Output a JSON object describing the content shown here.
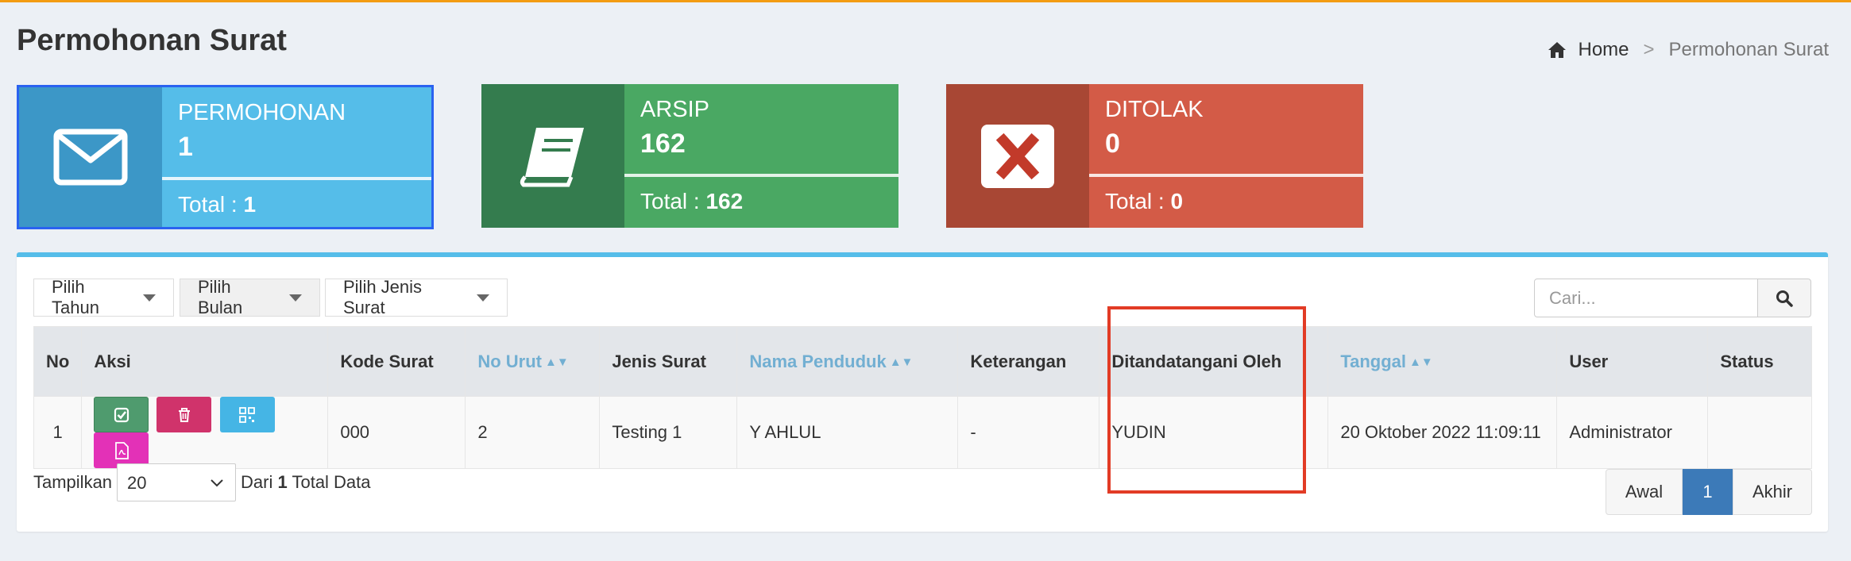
{
  "page": {
    "title": "Permohonan Surat"
  },
  "breadcrumb": {
    "home": "Home",
    "separator": ">",
    "current": "Permohonan Surat"
  },
  "infoboxes": {
    "permohonan": {
      "label": "PERMOHONAN",
      "number": "1",
      "total_label": "Total : ",
      "total_value": "1",
      "icon": "envelope-icon",
      "color": "#55bde9"
    },
    "arsip": {
      "label": "ARSIP",
      "number": "162",
      "total_label": "Total : ",
      "total_value": "162",
      "icon": "book-icon",
      "color": "#4aa863"
    },
    "ditolak": {
      "label": "DITOLAK",
      "number": "0",
      "total_label": "Total : ",
      "total_value": "0",
      "icon": "close-icon",
      "color": "#d35b47"
    }
  },
  "filters": {
    "tahun": "Pilih Tahun",
    "bulan": "Pilih Bulan",
    "jenis": "Pilih Jenis Surat"
  },
  "search": {
    "placeholder": "Cari..."
  },
  "table": {
    "headers": {
      "no": "No",
      "aksi": "Aksi",
      "kode": "Kode Surat",
      "urut": "No Urut",
      "jenis": "Jenis Surat",
      "nama": "Nama Penduduk",
      "ket": "Keterangan",
      "ttd": "Ditandatangani Oleh",
      "tanggal": "Tanggal",
      "user": "User",
      "status": "Status"
    },
    "rows": [
      {
        "no": "1",
        "kode": "000",
        "urut": "2",
        "jenis": "Testing 1",
        "nama": "Y AHLUL",
        "ket": "-",
        "ttd": "YUDIN",
        "tanggal": "20 Oktober 2022 11:09:11",
        "user": "Administrator",
        "status": ""
      }
    ]
  },
  "footer": {
    "show_label": "Tampilkan",
    "per_page": "20",
    "from_label": "Dari ",
    "count": "1",
    "total_label": " Total Data"
  },
  "pagination": {
    "first": "Awal",
    "current": "1",
    "last": "Akhir"
  },
  "colors": {
    "accent": "#55bde9",
    "highlight": "#e23b25",
    "topline": "#f39c12"
  }
}
